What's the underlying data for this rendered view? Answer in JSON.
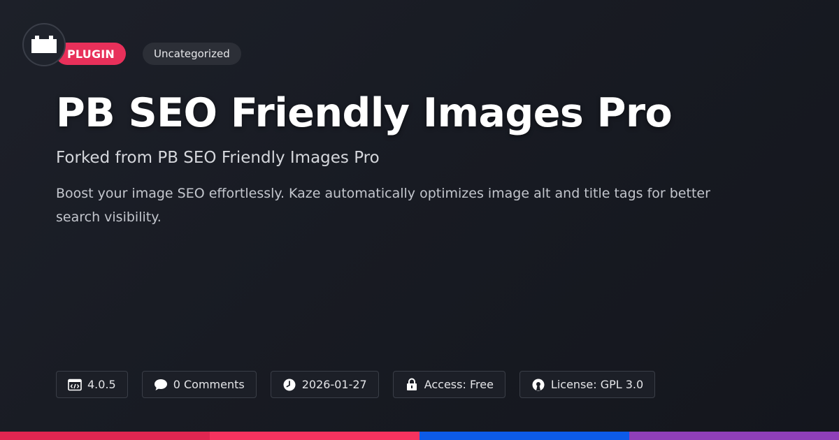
{
  "logo": {
    "icon": "plugin-block-icon"
  },
  "tags": {
    "type_label": "PLUGIN",
    "category_label": "Uncategorized"
  },
  "title": "PB SEO Friendly Images Pro",
  "subtitle": "Forked from PB SEO Friendly Images Pro",
  "description": "Boost your image SEO effortlessly. Kaze automatically optimizes image alt and title tags for better search visibility.",
  "meta": {
    "version": "4.0.5",
    "comments": "0 Comments",
    "date": "2026-01-27",
    "access": "Access: Free",
    "license": "License: GPL 3.0"
  },
  "icons": {
    "version": "code-window-icon",
    "comments": "speech-bubble-icon",
    "date": "clock-icon",
    "access": "lock-icon",
    "license": "open-source-icon"
  },
  "colors": {
    "accent": "#e8305a",
    "bar": [
      "#e02651",
      "#f6335f",
      "#0d5be8",
      "#8f3fb8"
    ]
  }
}
